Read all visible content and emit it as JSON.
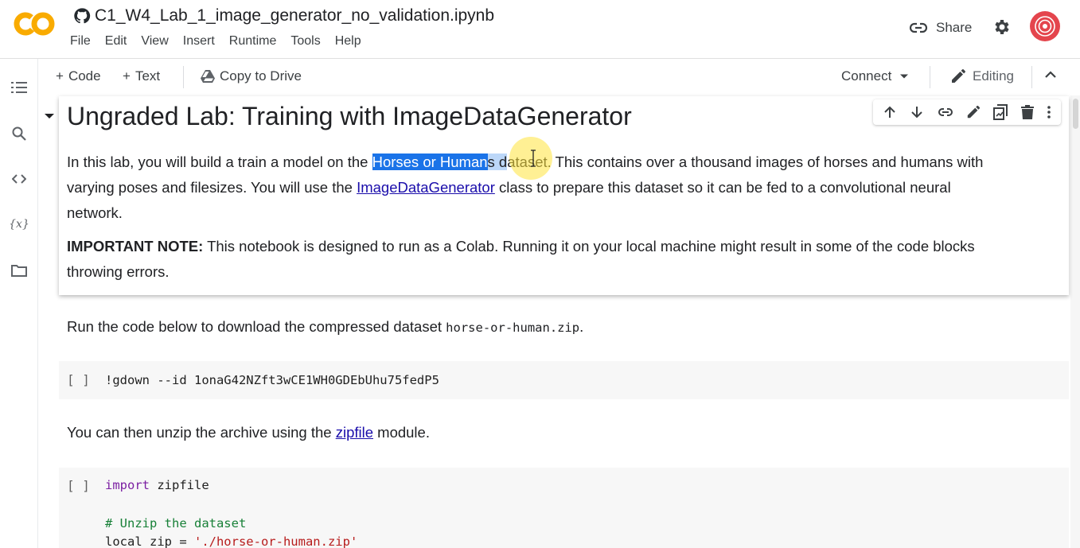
{
  "header": {
    "notebook_title": "C1_W4_Lab_1_image_generator_no_validation.ipynb",
    "logo_text": "CO",
    "menu": [
      "File",
      "Edit",
      "View",
      "Insert",
      "Runtime",
      "Tools",
      "Help"
    ],
    "share_label": "Share"
  },
  "toolbar": {
    "code_label": "Code",
    "text_label": "Text",
    "copy_to_drive_label": "Copy to Drive",
    "connect_label": "Connect",
    "editing_label": "Editing"
  },
  "sidebar": {
    "variables_label": "{x}"
  },
  "cells": {
    "heading": "Ungraded Lab: Training with ImageDataGenerator",
    "intro": {
      "before_link": "In this lab, you will build a train a model on the ",
      "highlight_link": "Horses or Human",
      "highlight_tail": "s d",
      "after_link": "ataset. This contains over a thousand images of horses and humans with",
      "line2_before": "varying poses and filesizes. You will use the ",
      "line2_link": "ImageDataGenerator",
      "line2_after": " class to prepare this dataset so it can be fed to a convolutional neural",
      "line3": "network."
    },
    "note": {
      "bold": "IMPORTANT NOTE:",
      "text": " This notebook is designed to run as a Colab. Running it on your local machine might result in some of the code blocks",
      "line2": "throwing errors."
    },
    "download_text": {
      "before": "Run the code below to download the compressed dataset ",
      "code": "horse-or-human.zip",
      "after": "."
    },
    "code1": {
      "run_label": "[ ]",
      "source": "!gdown --id 1onaG42NZft3wCE1WH0GDEbUhu75fedP5"
    },
    "unzip_text": {
      "before": "You can then unzip the archive using the ",
      "link": "zipfile",
      "after": " module."
    },
    "code2": {
      "run_label": "[ ]",
      "keyword": "import",
      "line1_rest": " zipfile",
      "comment": "# Unzip the dataset",
      "line3_code": "local_zip = ",
      "line3_str": "'./horse-or-human.zip'"
    }
  },
  "colors": {
    "accent": "#1a73e8",
    "link": "#1a0dab",
    "logo_orange": "#f9ab00",
    "avatar": "#e4454d"
  }
}
